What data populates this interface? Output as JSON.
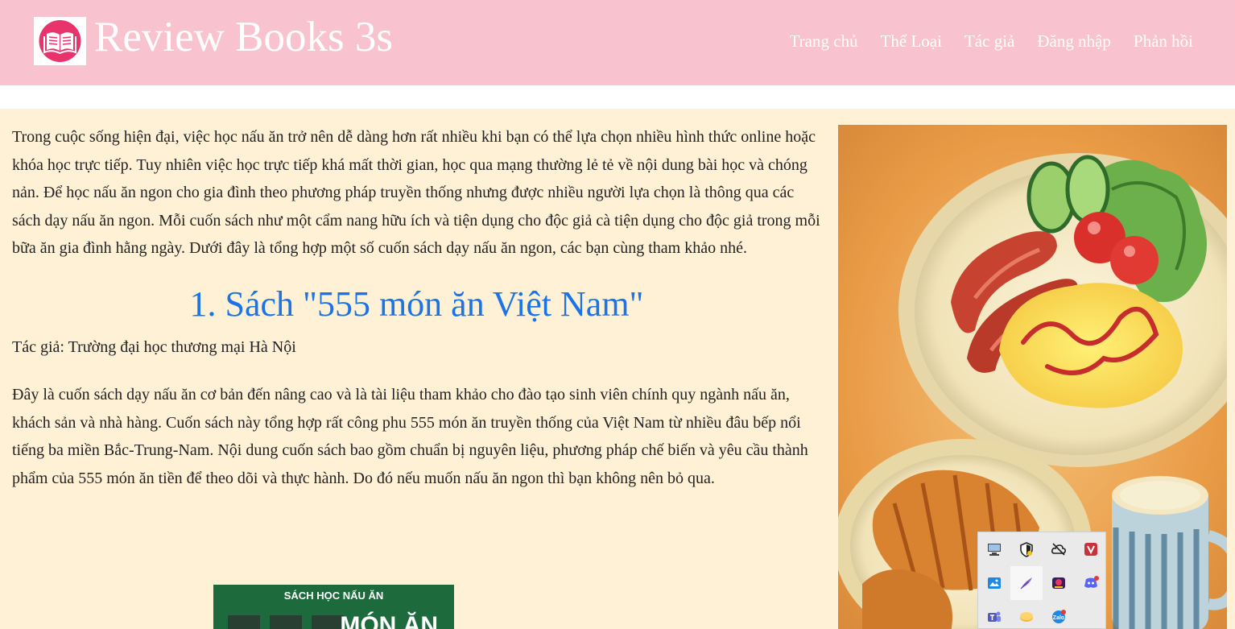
{
  "header": {
    "site_title": "Review Books 3s",
    "nav": [
      "Trang chủ",
      "Thể Loại",
      "Tác giả",
      "Đăng nhập",
      "Phản hồi"
    ]
  },
  "article": {
    "intro": "Trong cuộc sống hiện đại, việc học nấu ăn trở nên dễ dàng hơn rất nhiều khi bạn có thể lựa chọn nhiều hình thức online hoặc khóa học trực tiếp. Tuy nhiên việc học trực tiếp khá mất thời gian, học qua mạng thường lẻ tẻ về nội dung bài học và chóng nản. Để học nấu ăn ngon cho gia đình theo phương pháp truyền thống nhưng được nhiều người lựa chọn là thông qua các sách dạy nấu ăn ngon. Mỗi cuốn sách như một cẩm nang hữu ích và tiện dụng cho độc giả cà tiện dụng cho độc giả trong mỗi bữa ăn gia đình hằng ngày. Dưới đây là tổng hợp một số cuốn sách dạy nấu ăn ngon, các bạn cùng tham khảo nhé.",
    "book1_heading": "1. Sách \"555 món ăn Việt Nam\"",
    "book1_author": "Tác giả: Trường đại học thương mại Hà Nội",
    "book1_desc": "Đây là cuốn sách dạy nấu ăn cơ bản đến nâng cao và là tài liệu tham khảo cho đào tạo sinh viên chính quy ngành nấu ăn, khách sản và nhà hàng. Cuốn sách này tổng hợp rất công phu 555 món ăn truyền thống của Việt Nam từ nhiều đâu bếp nổi tiếng ba miền Bắc-Trung-Nam. Nội dung cuốn sách bao gồm chuẩn bị nguyên liệu, phương pháp chế biến và yêu cầu thành phẩm của 555 món ăn tiền để theo dõi và thực hành. Do đó nếu muốn nấu ăn ngon thì bạn không nên bỏ qua.",
    "cover": {
      "top_text": "SÁCH HỌC NẤU ĂN",
      "big_text": "MÓN ĂN"
    }
  },
  "tray": {
    "icons": [
      "monitor-icon",
      "shield-icon",
      "cloud-off-icon",
      "v-app-icon",
      "photo-app-icon",
      "feather-pen-icon",
      "gamepad-app-icon",
      "discord-icon",
      "teams-icon",
      "eraser-icon",
      "zalo-icon"
    ]
  },
  "colors": {
    "header_bg": "#f8c3cf",
    "content_bg": "#fff1d6",
    "heading_blue": "#1a73e8",
    "logo_pink": "#e8336d"
  }
}
